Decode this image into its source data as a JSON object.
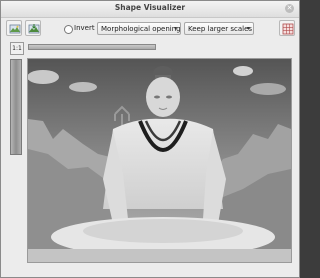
{
  "window": {
    "title": "Shape Visualizer"
  },
  "toolbar": {
    "open_icon": "folder-image-icon",
    "save_icon": "image-save-icon",
    "invert_label": "Invert",
    "operation_selected": "Morphological openings",
    "scale_selected": "Keep larger scales",
    "export_icon": "grid-export-icon"
  },
  "view": {
    "zoom_button_label": "1:1"
  }
}
